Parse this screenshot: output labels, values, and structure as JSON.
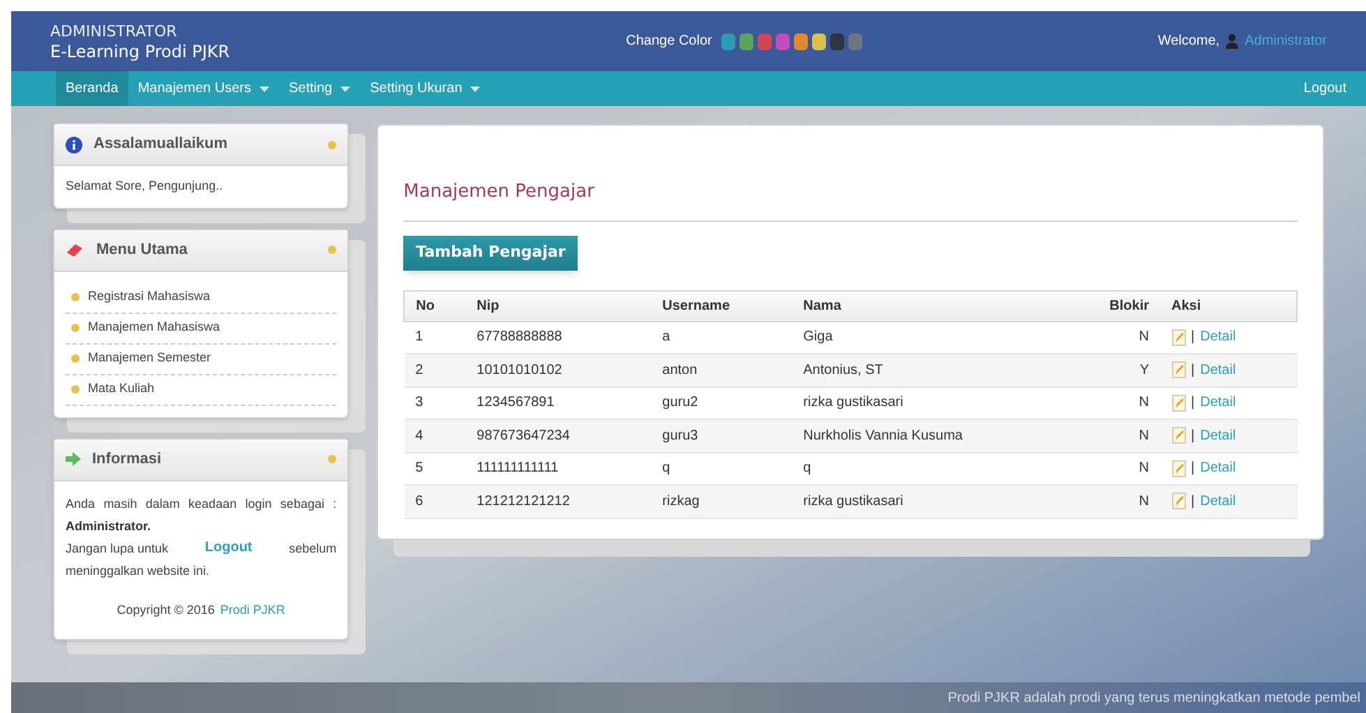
{
  "header": {
    "role": "ADMINISTRATOR",
    "site": "E-Learning Prodi PJKR",
    "change_color_label": "Change Color",
    "swatches": [
      {
        "color": "#2b9cb3"
      },
      {
        "color": "#5aa55a"
      },
      {
        "color": "#d0454f"
      },
      {
        "color": "#c24cb8"
      },
      {
        "color": "#e08a2c"
      },
      {
        "color": "#d9c04a"
      },
      {
        "color": "#2f3540"
      },
      {
        "color": "#6c7580"
      }
    ],
    "welcome": "Welcome,",
    "user": "Administrator"
  },
  "nav": {
    "items": [
      {
        "label": "Beranda",
        "dropdown": false,
        "selected": true
      },
      {
        "label": "Manajemen Users",
        "dropdown": true,
        "selected": false
      },
      {
        "label": "Setting",
        "dropdown": true,
        "selected": false
      },
      {
        "label": "Setting Ukuran",
        "dropdown": true,
        "selected": false
      }
    ],
    "logout": "Logout"
  },
  "sidebar": {
    "greeting": {
      "title": "Assalamuallaikum",
      "text": "Selamat Sore, Pengunjung.."
    },
    "menu": {
      "title": "Menu Utama",
      "items": [
        "Registrasi Mahasiswa",
        "Manajemen Mahasiswa",
        "Manajemen Semester",
        "Mata Kuliah"
      ]
    },
    "info": {
      "title": "Informasi",
      "line1": "Anda masih dalam keadaan login sebagai :",
      "user": "Administrator.",
      "line2_before": "Jangan lupa untuk",
      "logout_link": "Logout",
      "line2_after": "sebelum meninggalkan website ini.",
      "copyright": "Copyright © 2016",
      "copyright_link": "Prodi PJKR"
    }
  },
  "main": {
    "title": "Manajemen Pengajar",
    "add_button": "Tambah Pengajar",
    "table": {
      "columns": [
        "No",
        "Nip",
        "Username",
        "Nama",
        "Blokir",
        "Aksi"
      ],
      "rows": [
        {
          "no": "1",
          "nip": "67788888888",
          "username": "a",
          "nama": "Giga",
          "blokir": "N",
          "separator": "|",
          "detail": "Detail"
        },
        {
          "no": "2",
          "nip": "10101010102",
          "username": "anton",
          "nama": "Antonius, ST",
          "blokir": "Y",
          "separator": "|",
          "detail": "Detail"
        },
        {
          "no": "3",
          "nip": "1234567891",
          "username": "guru2",
          "nama": "rizka gustikasari",
          "blokir": "N",
          "separator": "|",
          "detail": "Detail"
        },
        {
          "no": "4",
          "nip": "987673647234",
          "username": "guru3",
          "nama": "Nurkholis Vannia Kusuma",
          "blokir": "N",
          "separator": "|",
          "detail": "Detail"
        },
        {
          "no": "5",
          "nip": "111111111111",
          "username": "q",
          "nama": "q",
          "blokir": "N",
          "separator": "|",
          "detail": "Detail"
        },
        {
          "no": "6",
          "nip": "121212121212",
          "username": "rizkag",
          "nama": "rizka gustikasari",
          "blokir": "N",
          "separator": "|",
          "detail": "Detail"
        }
      ]
    }
  },
  "footer": {
    "marquee": "Prodi PJKR adalah prodi yang terus meningkatkan metode pembel"
  }
}
